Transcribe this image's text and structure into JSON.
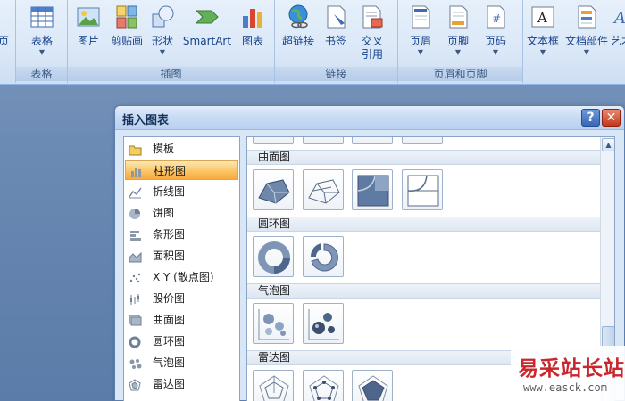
{
  "ribbon": {
    "groups": {
      "tables_label": "表格",
      "illustrations_label": "插图",
      "links_label": "链接",
      "header_footer_label": "页眉和页脚"
    },
    "buttons": {
      "page_partial": "页",
      "table": "表格",
      "picture": "图片",
      "clipart": "剪贴画",
      "shapes": "形状",
      "smartart": "SmartArt",
      "chart": "图表",
      "hyperlink": "超链接",
      "bookmark": "书签",
      "crossref_line1": "交叉",
      "crossref_line2": "引用",
      "header": "页眉",
      "footer": "页脚",
      "page_number": "页码",
      "textbox": "文本框",
      "quickparts": "文档部件",
      "wordart": "艺才"
    }
  },
  "dialog": {
    "title": "插入图表",
    "help": "?",
    "close": "✕",
    "categories": [
      {
        "label": "模板",
        "icon": "folder-icon"
      },
      {
        "label": "柱形图",
        "icon": "column-chart-icon",
        "selected": true
      },
      {
        "label": "折线图",
        "icon": "line-chart-icon"
      },
      {
        "label": "饼图",
        "icon": "pie-chart-icon"
      },
      {
        "label": "条形图",
        "icon": "bar-chart-icon"
      },
      {
        "label": "面积图",
        "icon": "area-chart-icon"
      },
      {
        "label": "X Y (散点图)",
        "icon": "scatter-chart-icon"
      },
      {
        "label": "股价图",
        "icon": "stock-chart-icon"
      },
      {
        "label": "曲面图",
        "icon": "surface-chart-icon"
      },
      {
        "label": "圆环图",
        "icon": "doughnut-chart-icon"
      },
      {
        "label": "气泡图",
        "icon": "bubble-chart-icon"
      },
      {
        "label": "雷达图",
        "icon": "radar-chart-icon"
      }
    ],
    "sections": {
      "surface": "曲面图",
      "doughnut": "圆环图",
      "bubble": "气泡图",
      "radar": "雷达图"
    }
  },
  "watermark": {
    "brand": "易采站长站",
    "url": "www.easck.com"
  },
  "colors": {
    "accent_blue": "#15428b",
    "selection_orange": "#f7a93c",
    "dialog_border": "#5a7eb0"
  }
}
